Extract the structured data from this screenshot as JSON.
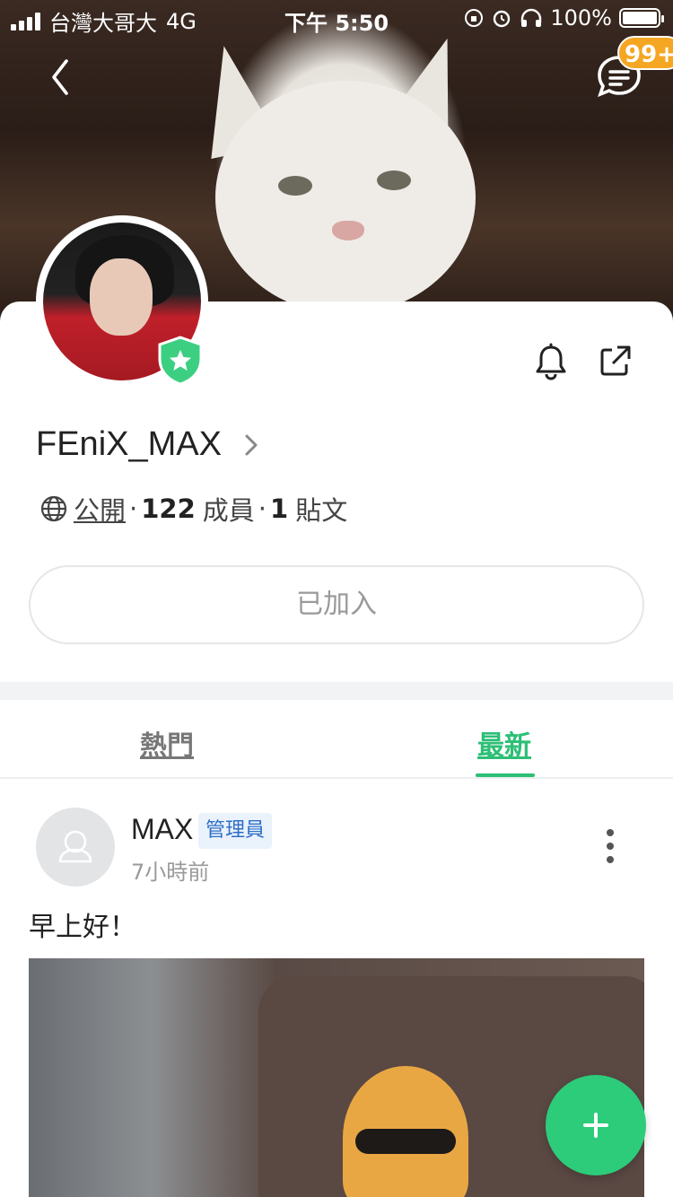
{
  "status_bar": {
    "carrier": "台灣大哥大",
    "network": "4G",
    "time": "下午 5:50",
    "battery": "100%",
    "battery_level": 1.0
  },
  "header": {
    "unread_badge": "99+"
  },
  "group": {
    "name": "FEniX_MAX",
    "privacy": "公開",
    "member_count": "122",
    "member_label": "成員",
    "post_count": "1",
    "post_label": "貼文",
    "joined_label": "已加入"
  },
  "tabs": [
    {
      "label": "熱門",
      "active": false
    },
    {
      "label": "最新",
      "active": true
    }
  ],
  "post": {
    "author": "MAX",
    "role_badge": "管理員",
    "time": "7小時前",
    "text": "早上好！"
  },
  "colors": {
    "accent": "#2dbf76",
    "fab": "#2dcc7a",
    "badge": "#f5a623",
    "admin_badge_text": "#2f6fc7",
    "admin_badge_bg": "#eaf2fb"
  },
  "icons": {
    "back": "chevron-left-icon",
    "chat": "chat-bubble-icon",
    "verified": "shield-star-icon",
    "bell": "bell-icon",
    "share": "external-link-icon",
    "globe": "globe-icon",
    "more": "more-vertical-icon",
    "fab": "plus-icon"
  }
}
